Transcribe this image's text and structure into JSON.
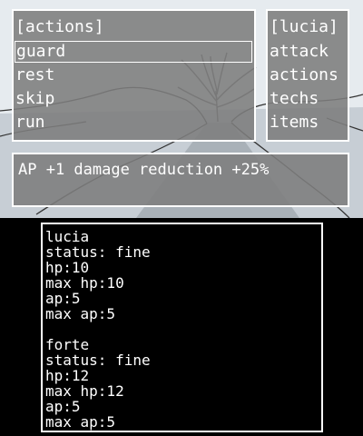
{
  "actions_menu": {
    "title": "[actions]",
    "items": [
      "guard",
      "rest",
      "skip",
      "run"
    ],
    "selected": "guard"
  },
  "party_menu": {
    "title": "[lucia]",
    "items": [
      "attack",
      "actions",
      "techs",
      "items"
    ]
  },
  "info": {
    "text": "AP +1 damage reduction +25%"
  },
  "party_status": [
    {
      "name": "lucia",
      "status": "status: fine",
      "hp": "hp:10",
      "max_hp": "max hp:10",
      "ap": "ap:5",
      "max_ap": "max ap:5"
    },
    {
      "name": "forte",
      "status": "status: fine",
      "hp": "hp:12",
      "max_hp": "max hp:12",
      "ap": "ap:5",
      "max_ap": "max ap:5"
    }
  ],
  "colors": {
    "panel_fill": "#7d7d7d",
    "panel_border": "#ffffff",
    "text": "#ffffff",
    "bottom_background": "#000000"
  }
}
